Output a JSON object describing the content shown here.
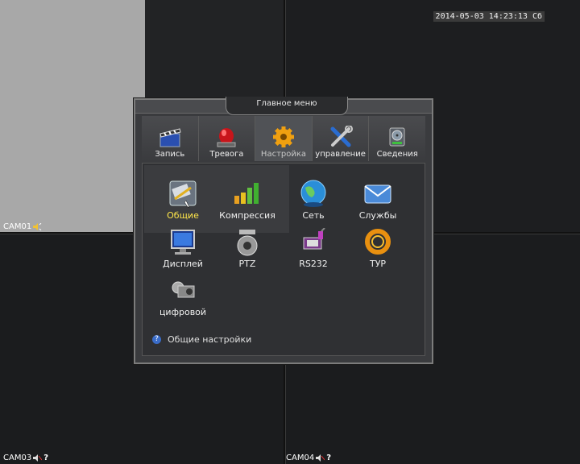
{
  "timestamp": "2014-05-03 14:23:13 Сб",
  "cameras": [
    {
      "label": "CAM01"
    },
    {
      "label": "CAM03"
    },
    {
      "label": "CAM04"
    }
  ],
  "menu": {
    "title": "Главное меню",
    "tabs": [
      {
        "label": "Запись",
        "icon": "clapperboard-icon"
      },
      {
        "label": "Тревога",
        "icon": "alarm-siren-icon"
      },
      {
        "label": "Настройка",
        "icon": "gear-icon",
        "active": true
      },
      {
        "label": "управление",
        "icon": "tools-icon"
      },
      {
        "label": "Сведения",
        "icon": "hdd-info-icon"
      }
    ],
    "items": [
      {
        "label": "Общие",
        "icon": "general-settings-icon",
        "selected": true
      },
      {
        "label": "Компрессия",
        "icon": "bar-chart-icon"
      },
      {
        "label": "Сеть",
        "icon": "globe-icon"
      },
      {
        "label": "Службы",
        "icon": "envelope-icon"
      },
      {
        "label": "Дисплей",
        "icon": "monitor-icon"
      },
      {
        "label": "PTZ",
        "icon": "ptz-camera-icon"
      },
      {
        "label": "RS232",
        "icon": "serial-port-icon"
      },
      {
        "label": "ТУР",
        "icon": "tour-loop-icon"
      },
      {
        "label": "цифровой",
        "icon": "digital-camera-icon"
      }
    ],
    "hint": "Общие настройки"
  },
  "colors": {
    "selected_label": "#ffe64a",
    "menu_bg": "#3a3b3e",
    "content_bg": "#2f3033"
  }
}
